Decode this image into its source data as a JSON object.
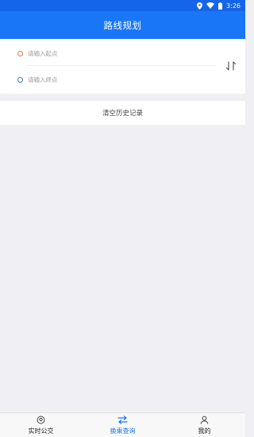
{
  "status_bar": {
    "time": "3:26",
    "icons": [
      "location-icon",
      "wifi-icon",
      "battery-icon"
    ]
  },
  "header": {
    "title": "路线规划"
  },
  "route": {
    "start_placeholder": "请输入起点",
    "end_placeholder": "请输入终点",
    "start_value": "",
    "end_value": "",
    "swap_icon": "swap-vertical-icon"
  },
  "history": {
    "clear_label": "清空历史记录"
  },
  "tab_bar": {
    "tabs": [
      {
        "label": "实时公交",
        "icon": "map-pin-icon",
        "active": false
      },
      {
        "label": "换乘查询",
        "icon": "transfer-icon",
        "active": true
      },
      {
        "label": "我的",
        "icon": "user-icon",
        "active": false
      }
    ]
  },
  "colors": {
    "header_bg": "#1976f7",
    "status_bg": "#1565e8",
    "accent": "#1976f7",
    "start_dot": "#e07a4a",
    "end_dot": "#3f6fd6",
    "page_bg": "#efeff4"
  }
}
